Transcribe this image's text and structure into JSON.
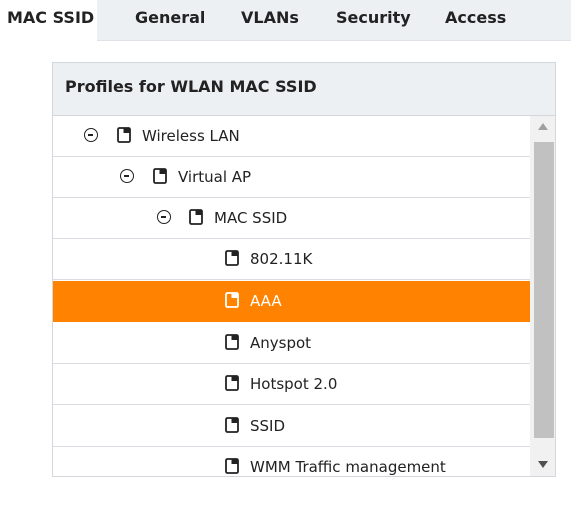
{
  "tabs": [
    {
      "label": "MAC SSID",
      "active": true
    },
    {
      "label": "General",
      "active": false
    },
    {
      "label": "VLANs",
      "active": false
    },
    {
      "label": "Security",
      "active": false
    },
    {
      "label": "Access",
      "active": false
    }
  ],
  "panel": {
    "title": "Profiles for WLAN MAC SSID"
  },
  "tree": [
    {
      "label": "Wireless LAN",
      "level": 0,
      "expanded": true,
      "selected": false
    },
    {
      "label": "Virtual AP",
      "level": 1,
      "expanded": true,
      "selected": false
    },
    {
      "label": "MAC SSID",
      "level": 2,
      "expanded": true,
      "selected": false
    },
    {
      "label": "802.11K",
      "level": 3,
      "selected": false
    },
    {
      "label": "AAA",
      "level": 3,
      "selected": true
    },
    {
      "label": "Anyspot",
      "level": 3,
      "selected": false
    },
    {
      "label": "Hotspot 2.0",
      "level": 3,
      "selected": false
    },
    {
      "label": "SSID",
      "level": 3,
      "selected": false
    },
    {
      "label": "WMM Traffic management",
      "level": 3,
      "selected": false
    }
  ],
  "colors": {
    "selected_row": "#ff8200",
    "tabbar_bg": "#edf0f3"
  },
  "icons": {
    "collapse": "minus-circle-icon",
    "profile": "profile-page-icon",
    "scroll_up": "scroll-up-arrow-icon",
    "scroll_down": "scroll-down-arrow-icon"
  }
}
